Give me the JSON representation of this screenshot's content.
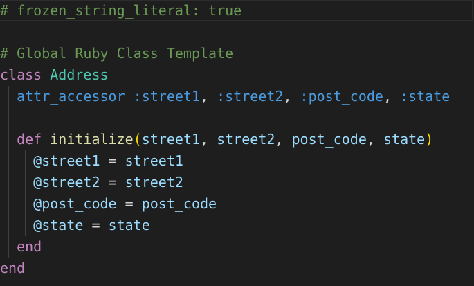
{
  "editor": {
    "lines": [
      {
        "comment": "# frozen_string_literal: true"
      },
      {},
      {
        "comment": "# Global Ruby Class Template"
      },
      {
        "keyword": "class",
        "name": "Address"
      },
      {
        "method": "attr_accessor",
        "symbols": [
          ":street1",
          ":street2",
          ":post_code",
          ":state"
        ]
      },
      {},
      {
        "keyword": "def",
        "name": "initialize",
        "params": [
          "street1",
          "street2",
          "post_code",
          "state"
        ]
      },
      {
        "ivar": "@street1",
        "value": "street1"
      },
      {
        "ivar": "@street2",
        "value": "street2"
      },
      {
        "ivar": "@post_code",
        "value": "post_code"
      },
      {
        "ivar": "@state",
        "value": "state"
      },
      {
        "keyword": "end"
      },
      {
        "keyword": "end"
      }
    ]
  }
}
